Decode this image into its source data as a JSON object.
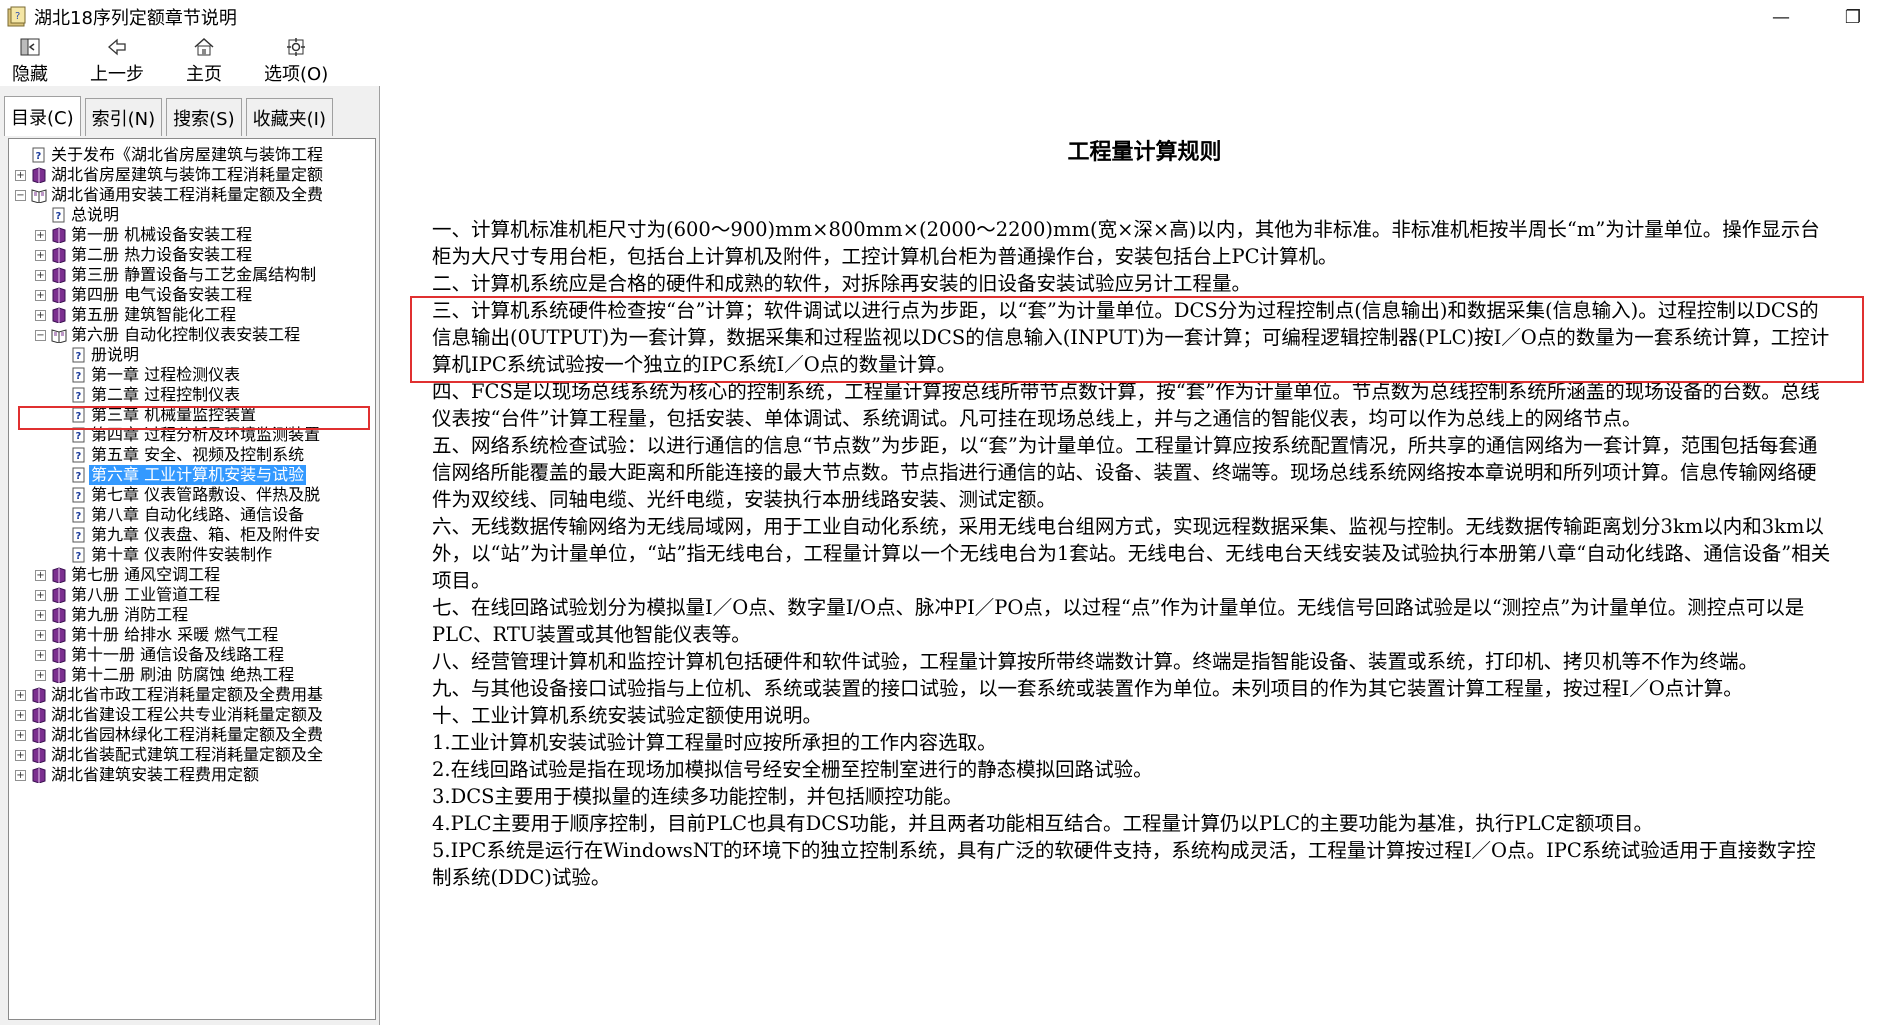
{
  "window": {
    "title": "湖北18序列定额章节说明",
    "minimize": "—",
    "maximize": "❐"
  },
  "toolbar": {
    "hide": "隐藏",
    "back": "上一步",
    "home": "主页",
    "options": "选项(O)"
  },
  "tabs": [
    "目录(C)",
    "索引(N)",
    "搜索(S)",
    "收藏夹(I)"
  ],
  "tree": [
    {
      "indent": 0,
      "type": "page",
      "label": "关于发布《湖北省房屋建筑与装饰工程"
    },
    {
      "indent": 0,
      "type": "book",
      "exp": "+",
      "label": "湖北省房屋建筑与装饰工程消耗量定额"
    },
    {
      "indent": 0,
      "type": "book-open",
      "exp": "−",
      "label": "湖北省通用安装工程消耗量定额及全费"
    },
    {
      "indent": 1,
      "type": "page",
      "label": "总说明"
    },
    {
      "indent": 1,
      "type": "book",
      "exp": "+",
      "label": "第一册  机械设备安装工程"
    },
    {
      "indent": 1,
      "type": "book",
      "exp": "+",
      "label": "第二册  热力设备安装工程"
    },
    {
      "indent": 1,
      "type": "book",
      "exp": "+",
      "label": "第三册  静置设备与工艺金属结构制"
    },
    {
      "indent": 1,
      "type": "book",
      "exp": "+",
      "label": "第四册  电气设备安装工程"
    },
    {
      "indent": 1,
      "type": "book",
      "exp": "+",
      "label": "第五册  建筑智能化工程"
    },
    {
      "indent": 1,
      "type": "book-open",
      "exp": "−",
      "label": "第六册  自动化控制仪表安装工程"
    },
    {
      "indent": 2,
      "type": "page",
      "label": "册说明"
    },
    {
      "indent": 2,
      "type": "page",
      "label": "第一章  过程检测仪表"
    },
    {
      "indent": 2,
      "type": "page",
      "label": "第二章  过程控制仪表"
    },
    {
      "indent": 2,
      "type": "page",
      "label": "第三章  机械量监控装置"
    },
    {
      "indent": 2,
      "type": "page",
      "label": "第四章  过程分析及环境监测装置"
    },
    {
      "indent": 2,
      "type": "page",
      "label": "第五章  安全、视频及控制系统"
    },
    {
      "indent": 2,
      "type": "page",
      "selected": true,
      "label": "第六章  工业计算机安装与试验"
    },
    {
      "indent": 2,
      "type": "page",
      "label": "第七章  仪表管路敷设、伴热及脱"
    },
    {
      "indent": 2,
      "type": "page",
      "label": "第八章  自动化线路、通信设备"
    },
    {
      "indent": 2,
      "type": "page",
      "label": "第九章  仪表盘、箱、柜及附件安"
    },
    {
      "indent": 2,
      "type": "page",
      "label": "第十章  仪表附件安装制作"
    },
    {
      "indent": 1,
      "type": "book",
      "exp": "+",
      "label": "第七册  通风空调工程"
    },
    {
      "indent": 1,
      "type": "book",
      "exp": "+",
      "label": "第八册  工业管道工程"
    },
    {
      "indent": 1,
      "type": "book",
      "exp": "+",
      "label": "第九册  消防工程"
    },
    {
      "indent": 1,
      "type": "book",
      "exp": "+",
      "label": "第十册  给排水  采暖  燃气工程"
    },
    {
      "indent": 1,
      "type": "book",
      "exp": "+",
      "label": "第十一册  通信设备及线路工程"
    },
    {
      "indent": 1,
      "type": "book",
      "exp": "+",
      "label": "第十二册  刷油  防腐蚀  绝热工程"
    },
    {
      "indent": 0,
      "type": "book",
      "exp": "+",
      "label": "湖北省市政工程消耗量定额及全费用基"
    },
    {
      "indent": 0,
      "type": "book",
      "exp": "+",
      "label": "湖北省建设工程公共专业消耗量定额及"
    },
    {
      "indent": 0,
      "type": "book",
      "exp": "+",
      "label": "湖北省园林绿化工程消耗量定额及全费"
    },
    {
      "indent": 0,
      "type": "book",
      "exp": "+",
      "label": "湖北省装配式建筑工程消耗量定额及全"
    },
    {
      "indent": 0,
      "type": "book",
      "exp": "+",
      "label": "湖北省建筑安装工程费用定额"
    }
  ],
  "document": {
    "title": "工程量计算规则",
    "paragraphs": [
      "一、计算机标准机柜尺寸为(600～900)mm×800mm×(2000～2200)mm(宽×深×高)以内，其他为非标准。非标准机柜按半周长“m”为计量单位。操作显示台柜为大尺寸专用台柜，包括台上计算机及附件，工控计算机台柜为普通操作台，安装包括台上PC计算机。",
      "二、计算机系统应是合格的硬件和成熟的软件，对拆除再安装的旧设备安装试验应另计工程量。",
      "三、计算机系统硬件检查按“台”计算；软件调试以进行点为步距，以“套”为计量单位。DCS分为过程控制点(信息输出)和数据采集(信息输入)。过程控制以DCS的信息输出(0UTPUT)为一套计算，数据采集和过程监视以DCS的信息输入(INPUT)为一套计算；可编程逻辑控制器(PLC)按I／O点的数量为一套系统计算，工控计算机IPC系统试验按一个独立的IPC系统I／O点的数量计算。",
      "四、FCS是以现场总线系统为核心的控制系统，工程量计算按总线所带节点数计算，按“套”作为计量单位。节点数为总线控制系统所涵盖的现场设备的台数。总线仪表按“台件”计算工程量，包括安装、单体调试、系统调试。凡可挂在现场总线上，并与之通信的智能仪表，均可以作为总线上的网络节点。",
      "五、网络系统检查试验：以进行通信的信息“节点数”为步距，以“套”为计量单位。工程量计算应按系统配置情况，所共享的通信网络为一套计算，范围包括每套通信网络所能覆盖的最大距离和所能连接的最大节点数。节点指进行通信的站、设备、装置、终端等。现场总线系统网络按本章说明和所列项计算。信息传输网络硬件为双绞线、同轴电缆、光纤电缆，安装执行本册线路安装、测试定额。",
      "六、无线数据传输网络为无线局域网，用于工业自动化系统，采用无线电台组网方式，实现远程数据采集、监视与控制。无线数据传输距离划分3km以内和3km以外，以“站”为计量单位，“站”指无线电台，工程量计算以一个无线电台为1套站。无线电台、无线电台天线安装及试验执行本册第八章“自动化线路、通信设备”相关项目。",
      "七、在线回路试验划分为模拟量I／O点、数字量I/O点、脉冲PI／PO点，以过程“点”作为计量单位。无线信号回路试验是以“测控点”为计量单位。测控点可以是PLC、RTU装置或其他智能仪表等。",
      "八、经营管理计算机和监控计算机包括硬件和软件试验，工程量计算按所带终端数计算。终端是指智能设备、装置或系统，打印机、拷贝机等不作为终端。",
      "九、与其他设备接口试验指与上位机、系统或装置的接口试验，以一套系统或装置作为单位。未列项目的作为其它装置计算工程量，按过程I／O点计算。",
      "十、工业计算机系统安装试验定额使用说明。",
      "1.工业计算机安装试验计算工程量时应按所承担的工作内容选取。",
      "2.在线回路试验是指在现场加模拟信号经安全栅至控制室进行的静态模拟回路试验。",
      "3.DCS主要用于模拟量的连续多功能控制，并包括顺控功能。",
      "4.PLC主要用于顺序控制，目前PLC也具有DCS功能，并且两者功能相互结合。工程量计算仍以PLC的主要功能为基准，执行PLC定额项目。",
      "5.IPC系统是运行在WindowsNT的环境下的独立控制系统，具有广泛的软硬件支持，系统构成灵活，工程量计算按过程I／O点。IPC系统试验适用于直接数字控制系统(DDC)试验。"
    ]
  }
}
